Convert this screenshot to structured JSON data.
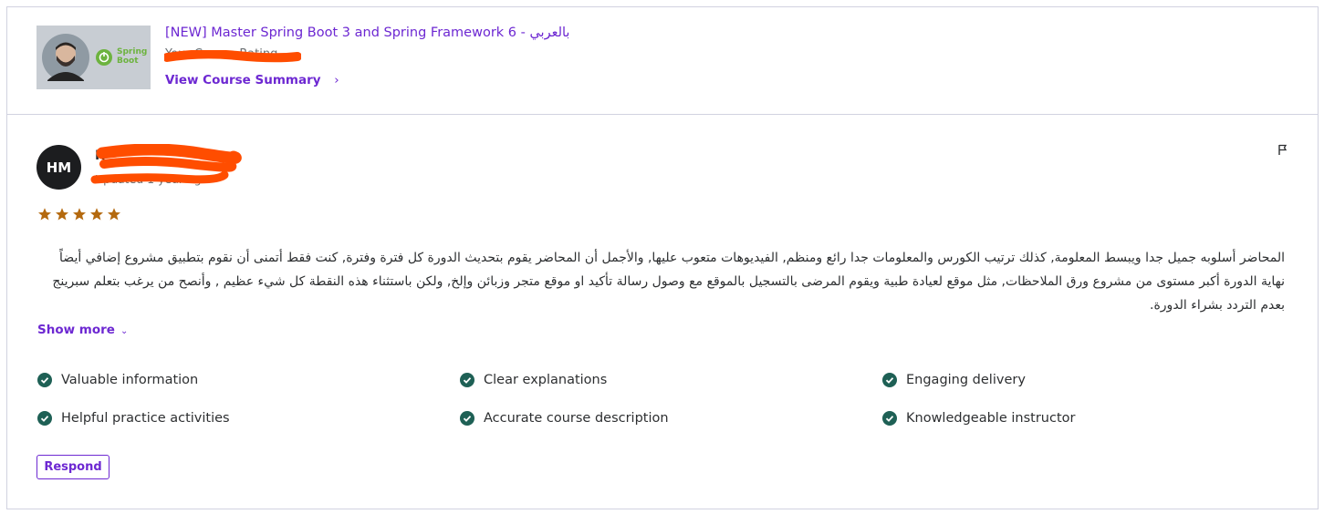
{
  "course": {
    "title": "[NEW] Master Spring Boot 3 and Spring Framework 6 - بالعربي",
    "subtitle": "Your Course Rating",
    "summary_link": "View Course Summary",
    "thumbnail_logo": "Spring Boot",
    "accent_color": "#6d28d2"
  },
  "review": {
    "avatar_initials": "HM",
    "reviewer_name": "H",
    "meta": "Updated 1 year ago",
    "rating": 5,
    "star_color": "#b4690e",
    "text": "المحاضر أسلوبه جميل جدا ويبسط المعلومة, كذلك ترتيب الكورس والمعلومات جدا رائع ومنظم, الفيديوهات متعوب عليها, والأجمل أن المحاضر يقوم بتحديث الدورة كل فترة وفترة, كنت فقط أتمنى أن نقوم بتطبيق مشروع إضافي أيضاً نهاية الدورة أكبر مستوى من مشروع ورق الملاحظات, مثل موقع لعيادة طبية ويقوم المرضى بالتسجيل بالموقع مع وصول رسالة تأكيد او موقع متجر وزبائن وإلخ, ولكن باستثناء هذه النقطة كل شيء عظيم , وأنصح من يرغب بتعلم سبرينج بعدم التردد بشراء الدورة.",
    "show_more": "Show more",
    "respond_label": "Respond"
  },
  "tags": [
    {
      "label": "Valuable information"
    },
    {
      "label": "Clear explanations"
    },
    {
      "label": "Engaging delivery"
    },
    {
      "label": "Helpful practice activities"
    },
    {
      "label": "Accurate course description"
    },
    {
      "label": "Knowledgeable instructor"
    }
  ],
  "icons": {
    "flag": "flag-icon",
    "check": "check-circle-icon",
    "chevron_right": "chevron-right-icon",
    "chevron_down": "chevron-down-icon",
    "star": "star-icon",
    "check_color": "#1e6055",
    "redaction_color": "#ff4d00"
  }
}
